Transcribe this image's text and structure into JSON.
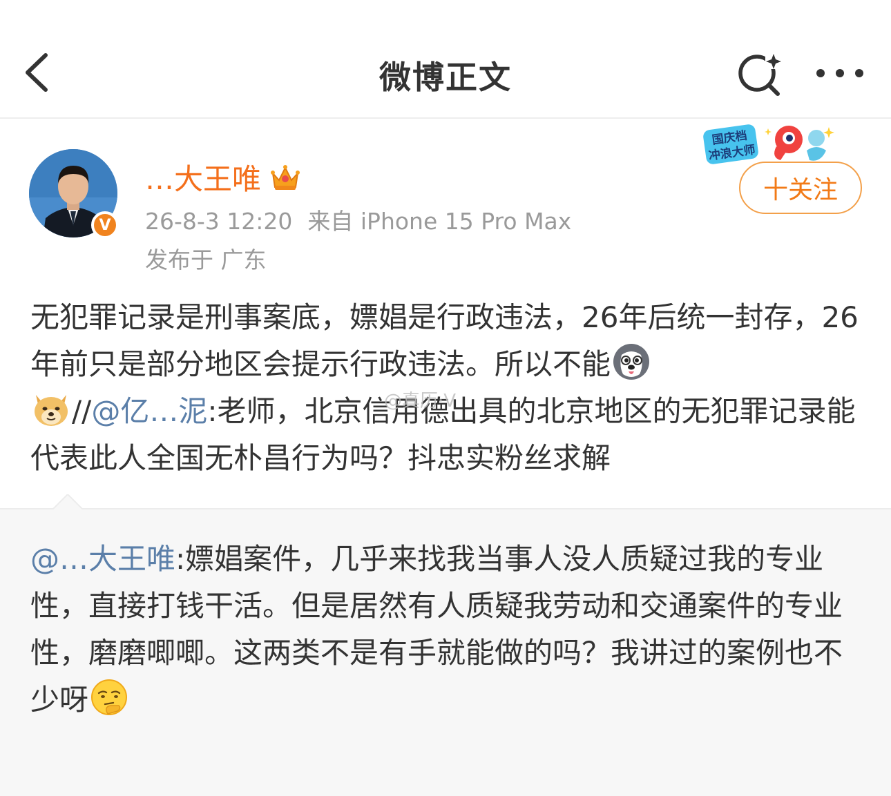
{
  "nav": {
    "title": "微博正文",
    "back_icon": "chevron-left-icon",
    "search_icon": "sparkle-search-icon",
    "more_icon": "more-dots-icon"
  },
  "post": {
    "author_name": "…大王唯",
    "author_badge": "crown-icon",
    "verified_badge": "V",
    "timestamp": "26-8-3 12:20",
    "source": "来自 iPhone 15 Pro Max",
    "location": "发布于 广东",
    "event_badge_lines": [
      "国庆档",
      "冲浪大师"
    ],
    "follow_label": "十关注",
    "text": {
      "part1": "无犯罪记录是刑事案底，嫖娼是行政违法，26年后统一封存，26年前只是部分地区会提示行政违法。所以不能",
      "slashes": "//",
      "mention": "@亿…泥",
      "part2": ":老师，北京信用德出具的北京地区的无犯罪记录能代表此人全国无朴昌行为吗？抖忠实粉丝求解"
    }
  },
  "watermark": "@真历·V",
  "retweet": {
    "mention": "@…大王唯",
    "text": ":嫖娼案件，几乎来找我当事人没人质疑过我的专业性，直接打钱干活。但是居然有人质疑我劳动和交通案件的专业性，磨磨唧唧。这两类不是有手就能做的吗？我讲过的案例也不少呀"
  },
  "colors": {
    "accent": "#f46f1b",
    "link": "#5b7fa9",
    "meta": "#9a9a9a",
    "retweet_bg": "#f7f7f7"
  }
}
